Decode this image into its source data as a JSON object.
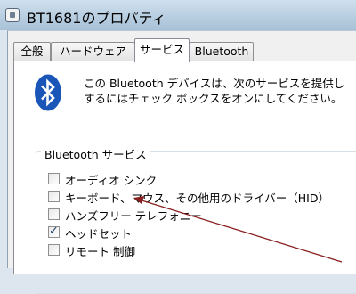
{
  "window": {
    "title": "BT1681のプロパティ"
  },
  "tabs": [
    {
      "label": "全般",
      "active": false
    },
    {
      "label": "ハードウェア",
      "active": false
    },
    {
      "label": "サービス",
      "active": true
    },
    {
      "label": "Bluetooth",
      "active": false
    }
  ],
  "panel": {
    "icon": "bluetooth-icon",
    "description_line1": "この Bluetooth デバイスは、次のサービスを提供し",
    "description_line2": "するにはチェック ボックスをオンにしてください。",
    "group_label": "Bluetooth サービス",
    "services": [
      {
        "label": "オーディオ シンク",
        "checked": false
      },
      {
        "label": "キーボード、マウス、その他用のドライバー（HID）",
        "checked": false
      },
      {
        "label": "ハンズフリー テレフォニー",
        "checked": false
      },
      {
        "label": "ヘッドセット",
        "checked": true
      },
      {
        "label": "リモート 制御",
        "checked": false
      }
    ]
  },
  "colors": {
    "titlebar": "#b6cde0",
    "bluetooth_blue": "#1a56b8",
    "annotation_arrow": "#8a1f1f"
  }
}
